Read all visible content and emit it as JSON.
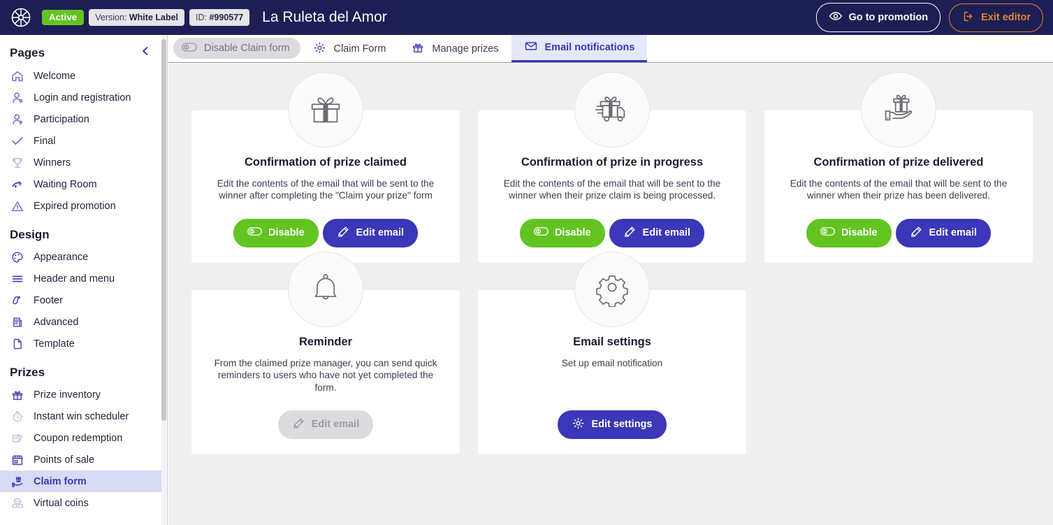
{
  "header": {
    "logo_icon": "roulette-wheel-icon",
    "status_badge": "Active",
    "version_prefix": "Version: ",
    "version_value": "White Label",
    "id_prefix": "ID: ",
    "id_value": "#990577",
    "promotion_title": "La Ruleta del Amor",
    "go_to_promotion_label": "Go to promotion",
    "exit_editor_label": "Exit editor",
    "bg_color": "#1d1f54",
    "active_badge_color": "#63c421",
    "exit_accent_color": "#e2852c"
  },
  "sidebar": {
    "title": "Pages",
    "collapse_icon": "chevron-left-icon",
    "groups": [
      {
        "title": "Pages",
        "items": [
          {
            "label": "Welcome",
            "icon": "home-icon"
          },
          {
            "label": "Login and registration",
            "icon": "user-login-icon"
          },
          {
            "label": "Participation",
            "icon": "user-participation-icon"
          },
          {
            "label": "Final",
            "icon": "check-icon"
          },
          {
            "label": "Winners",
            "icon": "trophy-icon"
          },
          {
            "label": "Waiting Room",
            "icon": "waiting-room-icon"
          },
          {
            "label": "Expired promotion",
            "icon": "warning-triangle-icon"
          }
        ]
      },
      {
        "title": "Design",
        "items": [
          {
            "label": "Appearance",
            "icon": "palette-icon"
          },
          {
            "label": "Header and menu",
            "icon": "menu-lines-icon"
          },
          {
            "label": "Footer",
            "icon": "footer-icon"
          },
          {
            "label": "Advanced",
            "icon": "document-code-icon"
          },
          {
            "label": "Template",
            "icon": "page-icon"
          }
        ]
      },
      {
        "title": "Prizes",
        "items": [
          {
            "label": "Prize inventory",
            "icon": "gift-icon"
          },
          {
            "label": "Instant win scheduler",
            "icon": "stopwatch-icon"
          },
          {
            "label": "Coupon redemption",
            "icon": "coupon-icon"
          },
          {
            "label": "Points of sale",
            "icon": "storefront-icon"
          },
          {
            "label": "Claim form",
            "icon": "hand-gift-icon",
            "active": true
          },
          {
            "label": "Virtual coins",
            "icon": "coins-icon"
          }
        ]
      }
    ],
    "active_bg": "#d9daf4",
    "active_text": "#3b37b8"
  },
  "tabs": [
    {
      "label": "Disable Claim form",
      "icon": "toggle-off-icon",
      "style": "toggle-pill"
    },
    {
      "label": "Claim Form",
      "icon": "gear-icon",
      "style": "normal"
    },
    {
      "label": "Manage prizes",
      "icon": "gift-icon",
      "style": "normal"
    },
    {
      "label": "Email notifications",
      "icon": "envelope-icon",
      "style": "active"
    }
  ],
  "cards": [
    {
      "title": "Confirmation of prize claimed",
      "description": "Edit the contents of the email that will be sent to the winner after completing the \"Claim your prize\" form",
      "icon": "gift-icon",
      "buttons": [
        {
          "label": "Disable",
          "icon": "toggle-icon",
          "style": "green"
        },
        {
          "label": "Edit email",
          "icon": "pencil-icon",
          "style": "blue"
        }
      ]
    },
    {
      "title": "Confirmation of prize in progress",
      "description": "Edit the contents of the email that will be sent to the winner when their prize claim is being processed.",
      "icon": "delivery-truck-gift-icon",
      "buttons": [
        {
          "label": "Disable",
          "icon": "toggle-icon",
          "style": "green"
        },
        {
          "label": "Edit email",
          "icon": "pencil-icon",
          "style": "blue"
        }
      ]
    },
    {
      "title": "Confirmation of prize delivered",
      "description": "Edit the contents of the email that will be sent to the winner when their prize has been delivered.",
      "icon": "hand-holding-gift-icon",
      "buttons": [
        {
          "label": "Disable",
          "icon": "toggle-icon",
          "style": "green"
        },
        {
          "label": "Edit email",
          "icon": "pencil-icon",
          "style": "blue"
        }
      ]
    },
    {
      "title": "Reminder",
      "description": "From the claimed prize manager, you can send quick reminders to users who have not yet completed the form.",
      "icon": "bell-icon",
      "buttons": [
        {
          "label": "Edit email",
          "icon": "pencil-icon",
          "style": "disabled"
        }
      ]
    },
    {
      "title": "Email settings",
      "description": "Set up email notification",
      "icon": "gear-icon",
      "buttons": [
        {
          "label": "Edit settings",
          "icon": "gear-icon",
          "style": "blue"
        }
      ]
    }
  ],
  "colors": {
    "primary_blue": "#3b37b8",
    "green": "#63c421",
    "canvas": "#efefef",
    "card": "#ffffff"
  }
}
